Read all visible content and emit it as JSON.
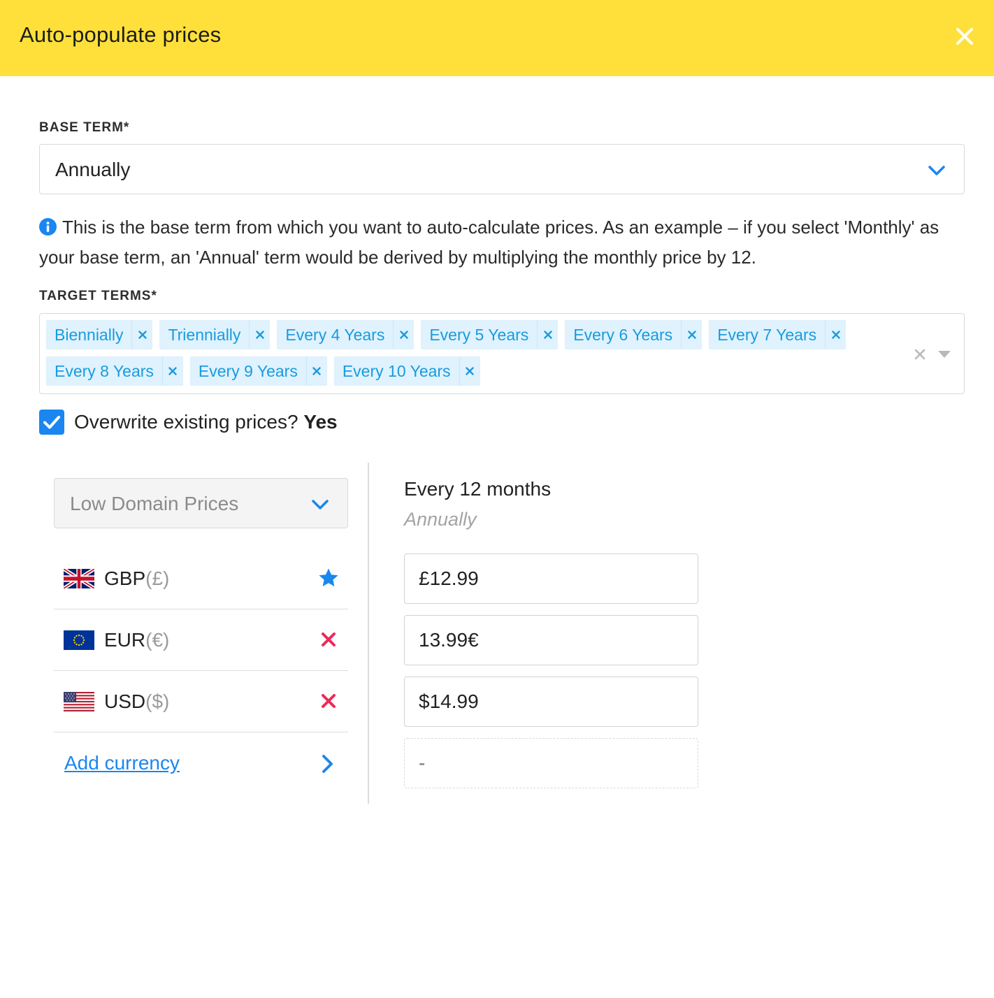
{
  "modal": {
    "title": "Auto-populate prices",
    "close_icon": "close-icon"
  },
  "base_term": {
    "label": "BASE TERM*",
    "value": "Annually",
    "info_icon": "info-icon",
    "info_text": "This is the base term from which you want to auto-calculate prices. As an example – if you select 'Monthly' as your base term, an 'Annual' term would be derived by multiplying the monthly price by 12."
  },
  "target_terms": {
    "label": "TARGET TERMS*",
    "tags": [
      "Biennially",
      "Triennially",
      "Every 4 Years",
      "Every 5 Years",
      "Every 6 Years",
      "Every 7 Years",
      "Every 8 Years",
      "Every 9 Years",
      "Every 10 Years"
    ]
  },
  "overwrite": {
    "checked": true,
    "label": "Overwrite existing prices?",
    "value": "Yes"
  },
  "price_list": {
    "selected": "Low Domain Prices"
  },
  "currencies": [
    {
      "code": "GBP",
      "symbol": "(£)",
      "action": "star-icon",
      "price": "£12.99"
    },
    {
      "code": "EUR",
      "symbol": "(€)",
      "action": "remove-icon",
      "price": "13.99€"
    },
    {
      "code": "USD",
      "symbol": "($)",
      "action": "remove-icon",
      "price": "$14.99"
    }
  ],
  "add_currency": {
    "label": "Add currency",
    "placeholder": "-"
  },
  "term_column": {
    "title": "Every 12 months",
    "subtitle": "Annually"
  },
  "colors": {
    "header_bg": "#ffe03a",
    "accent_blue": "#1a86f0",
    "tag_bg": "#dff2fd",
    "tag_text": "#1a9bde",
    "remove_red": "#ee2a55"
  }
}
